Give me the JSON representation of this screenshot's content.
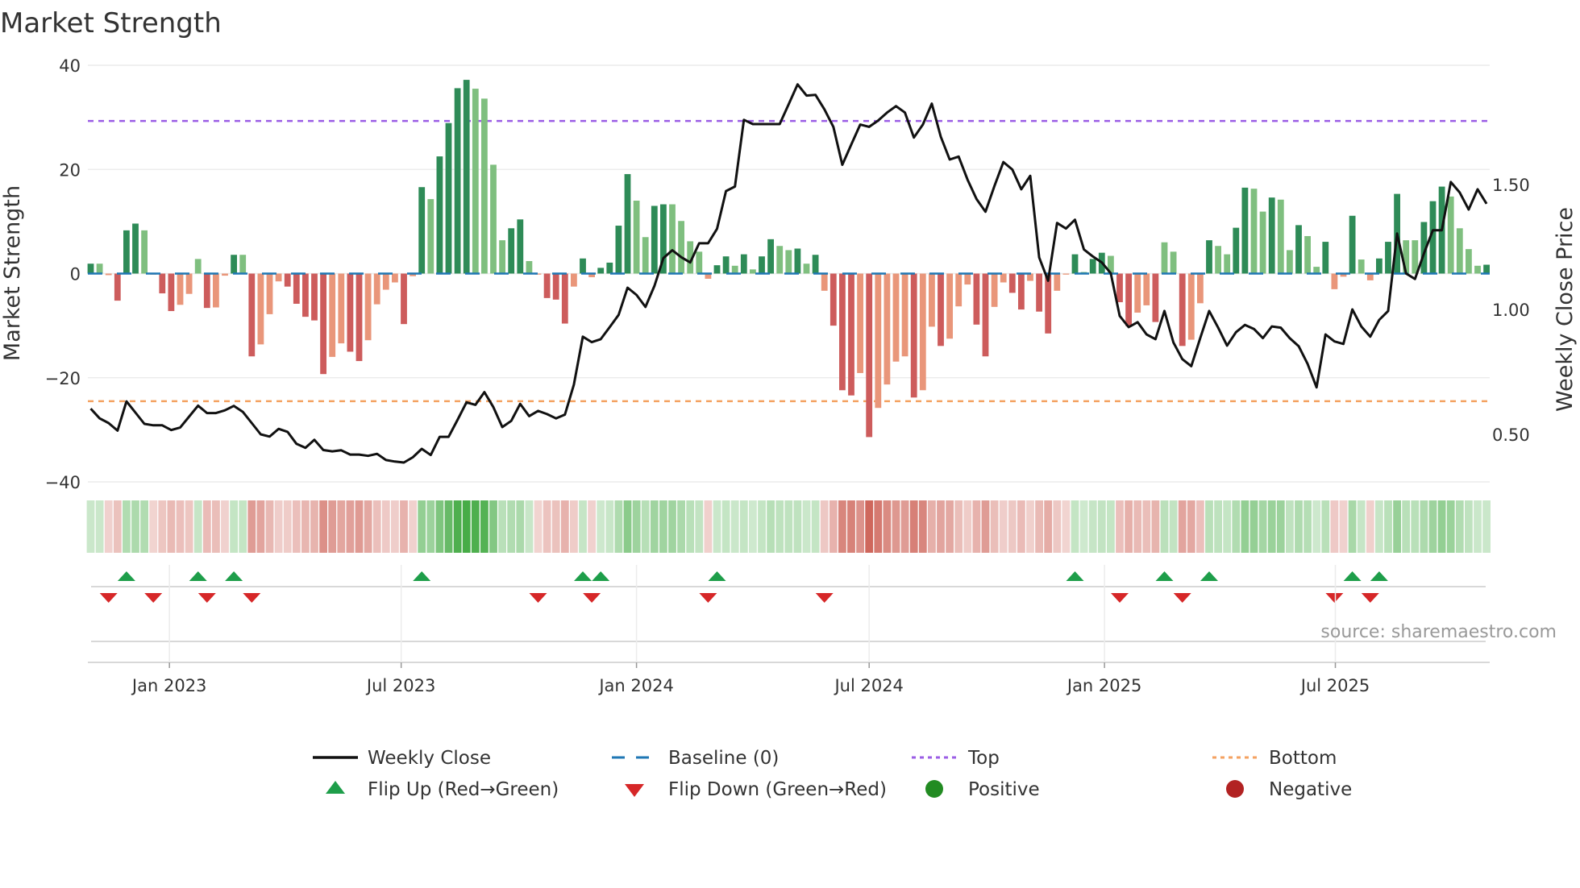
{
  "chart_data": {
    "type": "bar",
    "title": "Market Strength",
    "ylabel": "Market Strength",
    "y2label": "Weekly Close Price",
    "ylim": [
      -40,
      40
    ],
    "y2lim": [
      0.25,
      1.96
    ],
    "yticks": [
      40,
      20,
      0,
      -20,
      -40
    ],
    "ytick_labels": [
      "40",
      "20",
      "0",
      "−20",
      "−40"
    ],
    "y2ticks": [
      1.5,
      1.0,
      0.5
    ],
    "y2tick_labels": [
      "1.50",
      "1.00",
      "0.50"
    ],
    "xticks": [
      {
        "label": "Jan 2023",
        "bar_index": 9.8
      },
      {
        "label": "Jul 2023",
        "bar_index": 35.7
      },
      {
        "label": "Jan 2024",
        "bar_index": 62.0
      },
      {
        "label": "Jul 2024",
        "bar_index": 88.0
      },
      {
        "label": "Jan 2025",
        "bar_index": 114.3
      },
      {
        "label": "Jul 2025",
        "bar_index": 140.1
      }
    ],
    "top_level": 29.3,
    "bottom_level": -24.5,
    "baseline": 0,
    "strength": [
      1.9,
      1.9,
      -0.3,
      -5.2,
      8.3,
      9.6,
      8.3,
      -0.2,
      -3.8,
      -7.2,
      -6.0,
      -3.9,
      2.8,
      -6.6,
      -6.5,
      -0.4,
      3.6,
      3.6,
      -15.9,
      -13.6,
      -7.8,
      -1.5,
      -2.5,
      -5.8,
      -8.3,
      -9.0,
      -19.3,
      -16.0,
      -13.4,
      -15.0,
      -16.8,
      -12.8,
      -5.9,
      -3.1,
      -1.7,
      -9.7,
      -0.5,
      16.6,
      14.3,
      22.5,
      28.9,
      35.6,
      37.2,
      35.5,
      33.6,
      20.9,
      6.4,
      8.7,
      10.4,
      2.4,
      -0.2,
      -4.7,
      -5.0,
      -9.6,
      -2.5,
      2.9,
      -0.7,
      1.1,
      2.1,
      9.2,
      19.1,
      14.0,
      7.0,
      13.0,
      13.3,
      13.3,
      10.1,
      6.2,
      4.2,
      -1.0,
      1.6,
      3.3,
      1.5,
      3.7,
      0.8,
      3.3,
      6.6,
      5.3,
      4.5,
      4.8,
      1.9,
      3.6,
      -3.3,
      -10.0,
      -22.4,
      -23.4,
      -19.1,
      -31.4,
      -25.8,
      -21.3,
      -16.9,
      -15.9,
      -23.8,
      -22.4,
      -10.2,
      -13.9,
      -12.5,
      -6.3,
      -2.1,
      -9.8,
      -15.9,
      -6.4,
      -1.7,
      -3.7,
      -6.9,
      -1.4,
      -7.3,
      -11.5,
      -3.3,
      -0.2,
      3.7,
      0.3,
      2.8,
      4.0,
      3.4,
      -5.5,
      -10.1,
      -7.5,
      -6.1,
      -9.3,
      6.0,
      4.2,
      -13.9,
      -12.7,
      -5.7,
      6.4,
      5.3,
      3.7,
      8.8,
      16.5,
      16.3,
      11.9,
      14.6,
      14.2,
      4.5,
      9.3,
      7.2,
      1.3,
      6.1,
      -3.0,
      -0.6,
      11.1,
      2.7,
      -1.3,
      2.9,
      6.1,
      15.3,
      6.4,
      6.4,
      9.9,
      13.9,
      16.7,
      14.8,
      8.7,
      4.7,
      1.5,
      1.7
    ],
    "weekly_close": [
      0.603,
      0.564,
      0.545,
      0.515,
      0.632,
      0.587,
      0.542,
      0.536,
      0.536,
      0.517,
      0.527,
      0.571,
      0.615,
      0.585,
      0.585,
      0.596,
      0.614,
      0.59,
      0.545,
      0.5,
      0.491,
      0.522,
      0.51,
      0.462,
      0.446,
      0.478,
      0.437,
      0.432,
      0.436,
      0.419,
      0.419,
      0.414,
      0.422,
      0.397,
      0.391,
      0.387,
      0.408,
      0.442,
      0.417,
      0.49,
      0.49,
      0.558,
      0.628,
      0.618,
      0.669,
      0.609,
      0.529,
      0.554,
      0.622,
      0.573,
      0.594,
      0.581,
      0.564,
      0.579,
      0.699,
      0.891,
      0.869,
      0.881,
      0.929,
      0.978,
      1.087,
      1.058,
      1.01,
      1.094,
      1.205,
      1.237,
      1.209,
      1.188,
      1.265,
      1.265,
      1.323,
      1.474,
      1.492,
      1.759,
      1.742,
      1.742,
      1.742,
      1.742,
      1.821,
      1.901,
      1.856,
      1.859,
      1.801,
      1.731,
      1.579,
      1.66,
      1.74,
      1.731,
      1.756,
      1.788,
      1.814,
      1.788,
      1.688,
      1.74,
      1.824,
      1.692,
      1.6,
      1.612,
      1.519,
      1.442,
      1.391,
      1.494,
      1.59,
      1.56,
      1.481,
      1.535,
      1.208,
      1.115,
      1.346,
      1.324,
      1.359,
      1.24,
      1.212,
      1.188,
      1.145,
      0.974,
      0.929,
      0.949,
      0.9,
      0.881,
      0.994,
      0.868,
      0.801,
      0.773,
      0.885,
      0.994,
      0.927,
      0.855,
      0.909,
      0.938,
      0.922,
      0.885,
      0.932,
      0.927,
      0.885,
      0.853,
      0.782,
      0.688,
      0.9,
      0.872,
      0.862,
      1.0,
      0.932,
      0.891,
      0.958,
      0.994,
      1.304,
      1.144,
      1.122,
      1.224,
      1.317,
      1.317,
      1.51,
      1.468,
      1.4,
      1.481,
      1.423
    ],
    "legend": {
      "placement": "bottom",
      "entries": [
        {
          "label": "Weekly Close",
          "kind": "line",
          "color": "#111111"
        },
        {
          "label": "Baseline (0)",
          "kind": "dash",
          "color": "#1f77b4"
        },
        {
          "label": "Top",
          "kind": "dot",
          "color": "#9b5de5"
        },
        {
          "label": "Bottom",
          "kind": "dot",
          "color": "#f4a261"
        },
        {
          "label": "Flip Up (Red→Green)",
          "kind": "up",
          "color": "#1e9e4a"
        },
        {
          "label": "Flip Down (Green→Red)",
          "kind": "down",
          "color": "#d62728"
        },
        {
          "label": "Positive",
          "kind": "dot-circle",
          "color": "#228b22"
        },
        {
          "label": "Negative",
          "kind": "dot-circle",
          "color": "#b22222"
        }
      ]
    },
    "colors": {
      "pos_strong": "#2e8b57",
      "pos_weak": "#7fbf7f",
      "neg_strong": "#cd5c5c",
      "neg_weak": "#e9967a",
      "heat_pos": "#2ca02c",
      "heat_neg": "#c0392b",
      "top": "#9b5de5",
      "bottom": "#f4a261",
      "baseline": "#1f77b4",
      "close": "#111111"
    },
    "source": "source: sharemaestro.com"
  }
}
